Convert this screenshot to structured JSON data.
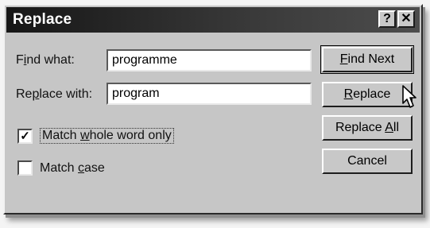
{
  "dialog": {
    "title": "Replace",
    "help_glyph": "?",
    "close_glyph": "✕"
  },
  "find": {
    "label_pre": "F",
    "label_u": "i",
    "label_post": "nd what:",
    "value": "programme"
  },
  "replace": {
    "label_pre": "Re",
    "label_u": "p",
    "label_post": "lace with:",
    "value": "program"
  },
  "options": {
    "whole_word": {
      "label_pre": "Match ",
      "label_u": "w",
      "label_post": "hole word only",
      "checked": true,
      "mark": "✓"
    },
    "match_case": {
      "label_pre": "Match ",
      "label_u": "c",
      "label_post": "ase",
      "checked": false
    }
  },
  "buttons": {
    "find_next": {
      "u": "F",
      "rest": "ind Next"
    },
    "replace": {
      "u": "R",
      "rest": "eplace"
    },
    "replace_all": {
      "pre": "Replace ",
      "u": "A",
      "rest": "ll"
    },
    "cancel": {
      "label": "Cancel"
    }
  },
  "icons": {
    "cursor": "arrow-pointer-icon"
  }
}
